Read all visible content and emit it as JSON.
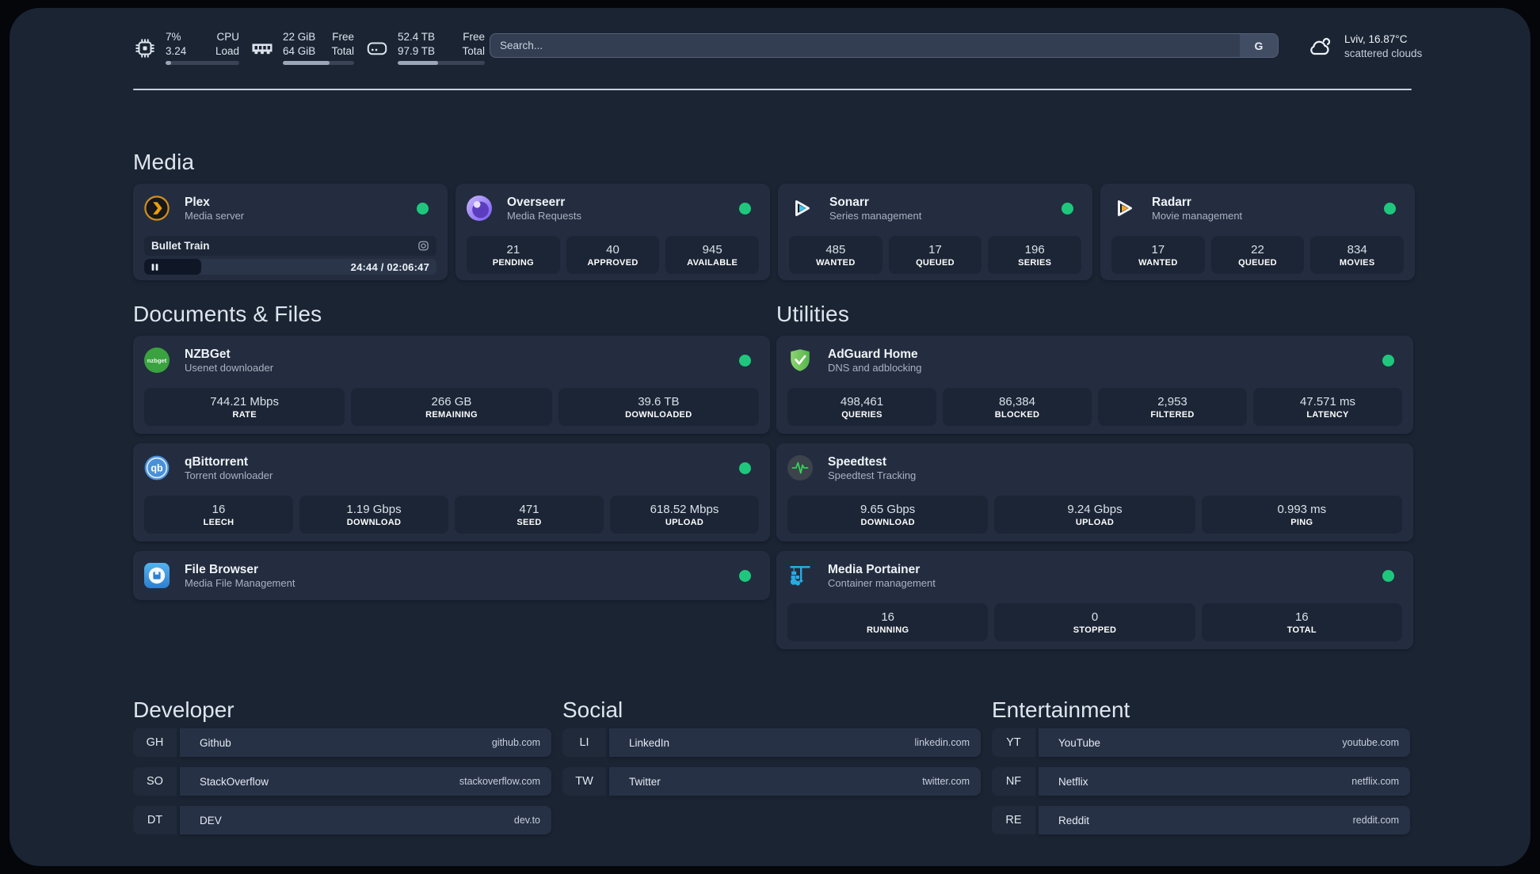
{
  "colors": {
    "status_online": "#1fc77d",
    "page_background": "#1b2433",
    "card_background": "#232d3f"
  },
  "topbar": {
    "stats": [
      {
        "icon": "cpu-icon",
        "values": [
          "7%",
          "3.24"
        ],
        "labels": [
          "CPU",
          "Load"
        ],
        "percent": 7
      },
      {
        "icon": "memory-icon",
        "values": [
          "22 GiB",
          "64 GiB"
        ],
        "labels": [
          "Free",
          "Total"
        ],
        "percent": 65
      },
      {
        "icon": "disk-icon",
        "values": [
          "52.4 TB",
          "97.9 TB"
        ],
        "labels": [
          "Free",
          "Total"
        ],
        "percent": 46
      }
    ],
    "search": {
      "placeholder": "Search...",
      "button_label": "G"
    },
    "weather": {
      "icon": "cloud-icon",
      "location_temp": "Lviv, 16.87°C",
      "condition": "scattered clouds"
    }
  },
  "service_groups": [
    {
      "id": "media",
      "title": "Media",
      "services": [
        {
          "icon": "plex-icon",
          "name": "Plex",
          "subtitle": "Media server",
          "online": true,
          "player": {
            "title": "Bullet Train",
            "time_text": "24:44 / 02:06:47",
            "progress_percent": 19.5,
            "state": "paused"
          }
        },
        {
          "icon": "overseerr-icon",
          "name": "Overseerr",
          "subtitle": "Media Requests",
          "online": true,
          "stats": [
            {
              "value": "21",
              "label": "PENDING"
            },
            {
              "value": "40",
              "label": "APPROVED"
            },
            {
              "value": "945",
              "label": "AVAILABLE"
            }
          ]
        },
        {
          "icon": "sonarr-icon",
          "name": "Sonarr",
          "subtitle": "Series management",
          "online": true,
          "stats": [
            {
              "value": "485",
              "label": "WANTED"
            },
            {
              "value": "17",
              "label": "QUEUED"
            },
            {
              "value": "196",
              "label": "SERIES"
            }
          ]
        },
        {
          "icon": "radarr-icon",
          "name": "Radarr",
          "subtitle": "Movie management",
          "online": true,
          "stats": [
            {
              "value": "17",
              "label": "WANTED"
            },
            {
              "value": "22",
              "label": "QUEUED"
            },
            {
              "value": "834",
              "label": "MOVIES"
            }
          ]
        }
      ]
    },
    {
      "id": "documents",
      "title": "Documents & Files",
      "services": [
        {
          "icon": "nzbget-icon",
          "name": "NZBGet",
          "subtitle": "Usenet downloader",
          "online": true,
          "stats": [
            {
              "value": "744.21 Mbps",
              "label": "RATE"
            },
            {
              "value": "266 GB",
              "label": "REMAINING"
            },
            {
              "value": "39.6 TB",
              "label": "DOWNLOADED"
            }
          ]
        },
        {
          "icon": "qbittorrent-icon",
          "name": "qBittorrent",
          "subtitle": "Torrent downloader",
          "online": true,
          "stats": [
            {
              "value": "16",
              "label": "LEECH"
            },
            {
              "value": "1.19 Gbps",
              "label": "DOWNLOAD"
            },
            {
              "value": "471",
              "label": "SEED"
            },
            {
              "value": "618.52 Mbps",
              "label": "UPLOAD"
            }
          ]
        },
        {
          "icon": "filebrowser-icon",
          "name": "File Browser",
          "subtitle": "Media File Management",
          "online": true
        }
      ]
    },
    {
      "id": "utilities",
      "title": "Utilities",
      "services": [
        {
          "icon": "adguard-icon",
          "name": "AdGuard Home",
          "subtitle": "DNS and adblocking",
          "online": true,
          "stats": [
            {
              "value": "498,461",
              "label": "QUERIES"
            },
            {
              "value": "86,384",
              "label": "BLOCKED"
            },
            {
              "value": "2,953",
              "label": "FILTERED"
            },
            {
              "value": "47.571 ms",
              "label": "LATENCY"
            }
          ]
        },
        {
          "icon": "speedtest-icon",
          "name": "Speedtest",
          "subtitle": "Speedtest Tracking",
          "online": null,
          "stats": [
            {
              "value": "9.65 Gbps",
              "label": "DOWNLOAD"
            },
            {
              "value": "9.24 Gbps",
              "label": "UPLOAD"
            },
            {
              "value": "0.993 ms",
              "label": "PING"
            }
          ]
        },
        {
          "icon": "portainer-icon",
          "name": "Media Portainer",
          "subtitle": "Container management",
          "online": true,
          "stats": [
            {
              "value": "16",
              "label": "RUNNING"
            },
            {
              "value": "0",
              "label": "STOPPED"
            },
            {
              "value": "16",
              "label": "TOTAL"
            }
          ]
        }
      ]
    }
  ],
  "bookmark_groups": [
    {
      "id": "developer",
      "title": "Developer",
      "bookmarks": [
        {
          "abbr": "GH",
          "name": "Github",
          "url": "github.com"
        },
        {
          "abbr": "SO",
          "name": "StackOverflow",
          "url": "stackoverflow.com"
        },
        {
          "abbr": "DT",
          "name": "DEV",
          "url": "dev.to"
        }
      ]
    },
    {
      "id": "social",
      "title": "Social",
      "bookmarks": [
        {
          "abbr": "LI",
          "name": "LinkedIn",
          "url": "linkedin.com"
        },
        {
          "abbr": "TW",
          "name": "Twitter",
          "url": "twitter.com"
        }
      ]
    },
    {
      "id": "entertainment",
      "title": "Entertainment",
      "bookmarks": [
        {
          "abbr": "YT",
          "name": "YouTube",
          "url": "youtube.com"
        },
        {
          "abbr": "NF",
          "name": "Netflix",
          "url": "netflix.com"
        },
        {
          "abbr": "RE",
          "name": "Reddit",
          "url": "reddit.com"
        }
      ]
    }
  ]
}
